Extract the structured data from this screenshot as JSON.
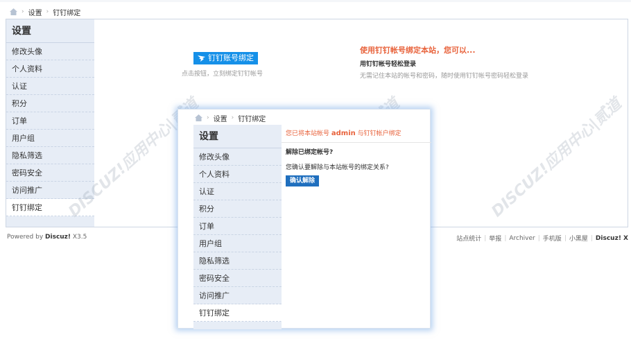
{
  "breadcrumb": {
    "home_icon": "home-icon",
    "items": [
      "设置",
      "钉钉绑定"
    ]
  },
  "sidebar": {
    "title": "设置",
    "items": [
      {
        "label": "修改头像"
      },
      {
        "label": "个人资料"
      },
      {
        "label": "认证"
      },
      {
        "label": "积分"
      },
      {
        "label": "订单"
      },
      {
        "label": "用户组"
      },
      {
        "label": "隐私筛选"
      },
      {
        "label": "密码安全"
      },
      {
        "label": "访问推广"
      },
      {
        "label": "钉钉绑定",
        "active": true
      }
    ]
  },
  "main": {
    "bind_button": "钉钉账号绑定",
    "bind_hint": "点击按钮，立刻绑定钉钉帐号",
    "promo_title": "使用钉钉帐号绑定本站，您可以...",
    "promo_subtitle": "用钉钉帐号轻松登录",
    "promo_desc": "无需记住本站的帐号和密码，随时使用钉钉帐号密码轻松登录"
  },
  "footer": {
    "powered_prefix": "Powered by ",
    "powered_brand": "Discuz!",
    "powered_version": " X3.5",
    "links": [
      "站点统计",
      "举报",
      "Archiver",
      "手机版",
      "小黑屋"
    ],
    "brand": "Discuz! X"
  },
  "popup": {
    "breadcrumb": [
      "设置",
      "钉钉绑定"
    ],
    "notice_prefix": "您已将本站帐号 ",
    "notice_user": "admin",
    "notice_suffix": " 与钉钉帐户绑定",
    "unbind_title": "解除已绑定帐号?",
    "unbind_question": "您确认要解除与本站帐号的绑定关系?",
    "confirm_button": "确认解除"
  },
  "watermark": "DISCUZ!应用中心|贰道",
  "colors": {
    "accent_blue": "#1590e8",
    "notice_orange": "#e8633c",
    "sidebar_bg": "#e7edf6"
  }
}
